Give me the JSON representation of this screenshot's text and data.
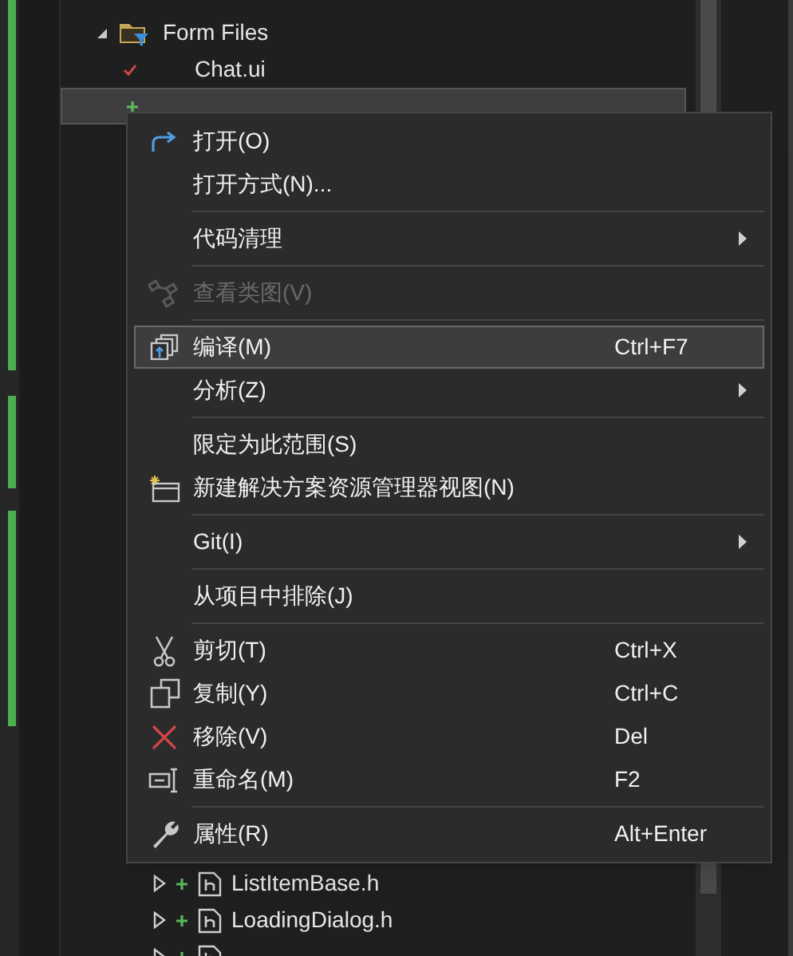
{
  "tree": {
    "rows": [
      {
        "label": "Form Files",
        "kind": "folder",
        "expanded": true,
        "selected": false
      },
      {
        "label": "Chat.ui",
        "kind": "file",
        "selected": false
      },
      {
        "kind": "file",
        "selected": true
      }
    ],
    "bottom_rows": [
      {
        "label": "ListItemBase.h",
        "expanded": false
      },
      {
        "label": "LoadingDialog.h",
        "expanded": false
      },
      {
        "expanded": false
      }
    ]
  },
  "context_menu": {
    "items": [
      {
        "kind": "item",
        "label": "打开(O)",
        "disabled": false,
        "selected": false
      },
      {
        "kind": "item",
        "label": "打开方式(N)...",
        "disabled": false,
        "selected": false
      },
      {
        "kind": "separator"
      },
      {
        "kind": "item",
        "label": "代码清理",
        "submenu": true,
        "disabled": false,
        "selected": false
      },
      {
        "kind": "separator"
      },
      {
        "kind": "item",
        "label": "查看类图(V)",
        "disabled": true,
        "selected": false
      },
      {
        "kind": "separator"
      },
      {
        "kind": "item",
        "label": "编译(M)",
        "shortcut": "Ctrl+F7",
        "disabled": false,
        "selected": true
      },
      {
        "kind": "item",
        "label": "分析(Z)",
        "submenu": true,
        "disabled": false,
        "selected": false
      },
      {
        "kind": "separator"
      },
      {
        "kind": "item",
        "label": "限定为此范围(S)",
        "disabled": false,
        "selected": false
      },
      {
        "kind": "item",
        "label": "新建解决方案资源管理器视图(N)",
        "disabled": false,
        "selected": false
      },
      {
        "kind": "separator"
      },
      {
        "kind": "item",
        "label": "Git(I)",
        "submenu": true,
        "disabled": false,
        "selected": false
      },
      {
        "kind": "separator"
      },
      {
        "kind": "item",
        "label": "从项目中排除(J)",
        "disabled": false,
        "selected": false
      },
      {
        "kind": "separator"
      },
      {
        "kind": "item",
        "label": "剪切(T)",
        "shortcut": "Ctrl+X",
        "disabled": false,
        "selected": false
      },
      {
        "kind": "item",
        "label": "复制(Y)",
        "shortcut": "Ctrl+C",
        "disabled": false,
        "selected": false
      },
      {
        "kind": "item",
        "label": "移除(V)",
        "shortcut": "Del",
        "disabled": false,
        "selected": false
      },
      {
        "kind": "item",
        "label": "重命名(M)",
        "shortcut": "F2",
        "disabled": false,
        "selected": false
      },
      {
        "kind": "separator"
      },
      {
        "kind": "item",
        "label": "属性(R)",
        "shortcut": "Alt+Enter",
        "disabled": false,
        "selected": false
      }
    ]
  }
}
